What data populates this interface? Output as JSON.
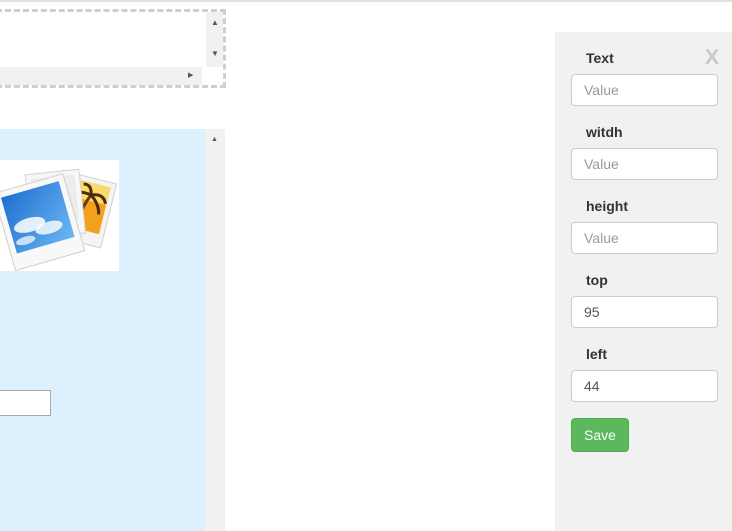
{
  "panel": {
    "close_label": "X",
    "fields": [
      {
        "label": "Text",
        "placeholder": "Value",
        "value": ""
      },
      {
        "label": "witdh",
        "placeholder": "Value",
        "value": ""
      },
      {
        "label": "height",
        "placeholder": "Value",
        "value": ""
      },
      {
        "label": "top",
        "placeholder": "Value",
        "value": "95"
      },
      {
        "label": "left",
        "placeholder": "Value",
        "value": "44"
      }
    ],
    "save_label": "Save"
  },
  "scroll_icons": {
    "up": "▲",
    "down": "▼",
    "right": "▶"
  },
  "colors": {
    "canvas_bg": "#dcf1fd",
    "panel_bg": "#f1f1f1",
    "save_button": "#5cb85c"
  }
}
